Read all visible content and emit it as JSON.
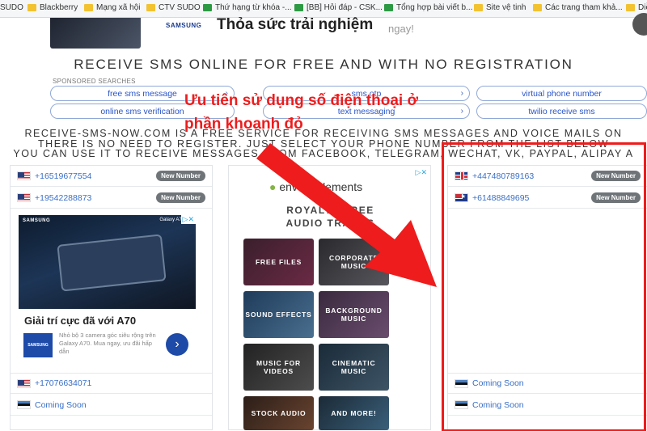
{
  "bookmarks": [
    {
      "label": "SUDO",
      "icon": "none"
    },
    {
      "label": "Blackberry",
      "icon": "folder-icon"
    },
    {
      "label": "Mạng xã hội",
      "icon": "folder-icon"
    },
    {
      "label": "CTV SUDO",
      "icon": "folder-icon"
    },
    {
      "label": "Thứ hạng từ khóa -...",
      "icon": "sheet-icon"
    },
    {
      "label": "[BB] Hỏi đáp - CSK...",
      "icon": "bb-icon"
    },
    {
      "label": "Tổng hợp bài viết b...",
      "icon": "sheet-icon"
    },
    {
      "label": "Site vệ tinh",
      "icon": "folder-icon"
    },
    {
      "label": "Các trang tham khả...",
      "icon": "folder-icon"
    },
    {
      "label": "Diễ",
      "icon": "folder-icon"
    }
  ],
  "top_ad": {
    "brand": "SAMSUNG",
    "headline": "Thỏa sức trải nghiệm",
    "text": "ngay!"
  },
  "hero_title": "RECEIVE SMS ONLINE FOR FREE AND WITH NO REGISTRATION",
  "sponsored_label": "SPONSORED SEARCHES",
  "sponsored_links": [
    "free sms message",
    "sms otp",
    "virtual phone number",
    "online sms verification",
    "text messaging",
    "twilio receive sms"
  ],
  "info_lines": [
    "RECEIVE-SMS-NOW.COM IS A FREE SERVICE FOR RECEIVING SMS MESSAGES AND VOICE MAILS ON",
    "THERE IS NO NEED TO REGISTER. JUST SELECT YOUR PHONE NUMBER FROM THE LIST BELOW",
    "YOU CAN USE IT TO RECEIVE MESSAGES FROM FACEBOOK, TELEGRAM, WECHAT, VK, PAYPAL, ALIPAY A"
  ],
  "left_column": {
    "numbers": [
      {
        "number": "+16519677554",
        "badge": "New Number",
        "flag": "us"
      },
      {
        "number": "+19542288873",
        "badge": "New Number",
        "flag": "us"
      }
    ],
    "ad": {
      "brand": "SAMSUNG",
      "model": "Galaxy A70",
      "title": "Giải trí cực đã với A70",
      "desc": "Nhỏ bộ 3 camera góc siêu rộng trên Galaxy A70. Mua ngay, ưu đãi hấp dẫn",
      "logo": "SAMSUNG"
    },
    "bottom": [
      {
        "number": "+17076634071",
        "flag": "us"
      },
      {
        "number": "Coming Soon",
        "flag": "ee"
      }
    ]
  },
  "middle_ad": {
    "brand": "envato elements",
    "headline_1": "ROYALTY FREE",
    "headline_2": "AUDIO TRACKS",
    "tiles": [
      "FREE FILES",
      "CORPORATE MUSIC",
      "SOUND EFFECTS",
      "BACKGROUND MUSIC",
      "MUSIC FOR VIDEOS",
      "CINEMATIC MUSIC",
      "STOCK AUDIO",
      "AND MORE!"
    ]
  },
  "right_column": {
    "numbers": [
      {
        "number": "+447480789163",
        "badge": "New Number",
        "flag": "uk"
      },
      {
        "number": "+61488849695",
        "badge": "New Number",
        "flag": "au"
      }
    ],
    "bottom": [
      {
        "number": "Coming Soon",
        "flag": "ee"
      },
      {
        "number": "Coming Soon",
        "flag": "ee"
      }
    ]
  },
  "annotation": {
    "line1": "Ưu tiên sử dụng số điện thoại ở",
    "line2": "phần khoanh đỏ",
    "color": "#ee1c1c"
  }
}
